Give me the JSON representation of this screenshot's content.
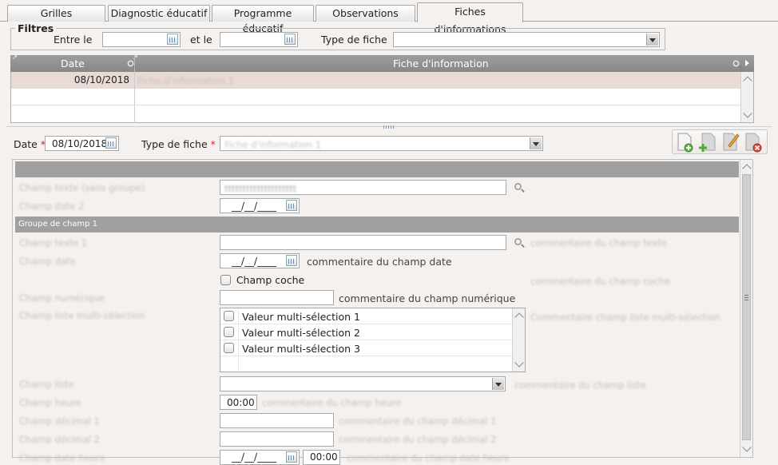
{
  "tabs": [
    "Grilles",
    "Diagnostic éducatif",
    "Programme éducatif",
    "Observations",
    "Fiches d'informations"
  ],
  "filters": {
    "legend": "Filtres",
    "between_label": "Entre le",
    "and_label": "et le",
    "type_label": "Type de fiche",
    "between_value": "",
    "and_value": "",
    "type_value": ""
  },
  "grid": {
    "col_date": "Date",
    "col_fiche": "Fiche d'information",
    "rows": [
      {
        "date": "08/10/2018",
        "fiche": "Fiche d'information 1"
      }
    ]
  },
  "detail": {
    "date_label": "Date",
    "date_value": "08/10/2018",
    "type_label": "Type de fiche",
    "type_value": "Fiche d'information 1",
    "required_mark": "*"
  },
  "form": {
    "field_text_nogroup_label": "Champ texte (sans groupe)",
    "field_text_nogroup_value": "tttttttttttttttttttt",
    "field_date2_label": "Champ date 2",
    "date_placeholder": "__/__/____",
    "group1_title": "Groupe de champ 1",
    "field_text1_label": "Champ texte 1",
    "field_text1_comment": "commentaire du champ texte",
    "field_date_label": "Champ date",
    "field_date_comment": "commentaire du champ date",
    "checkbox_label": "Champ coche",
    "checkbox_comment": "commentaire du champ coche",
    "field_num_label": "Champ numérique",
    "field_num_comment": "commentaire du champ numérique",
    "field_multi_label": "Champ liste multi-sélection",
    "field_multi_comment": "Commentaire champ liste multi-sélection",
    "multi_options": [
      "Valeur multi-sélection 1",
      "Valeur multi-sélection 2",
      "Valeur multi-sélection 3"
    ],
    "field_list_label": "Champ liste",
    "field_list_comment": "commentaire du champ liste",
    "field_hour_label": "Champ heure",
    "field_hour_value": "00:00",
    "field_hour_comment": "commentaire du champ heure",
    "field_dec1_label": "Champ décimal 1",
    "field_dec1_comment": "commentaire du champ décimal 1",
    "field_dec2_label": "Champ décimal 2",
    "field_dec2_comment": "commentaire du champ décimal 2",
    "field_datetime_label": "Champ date heure",
    "field_datetime_hour": "00:00",
    "field_datetime_comment": "commentaire du champ date heure"
  },
  "icons": [
    "calendar-icon",
    "magnifier-icon",
    "new-doc-icon",
    "add-icon",
    "edit-icon",
    "delete-icon",
    "dropdown-arrow-icon",
    "scroll-up-icon",
    "scroll-down-icon"
  ],
  "colors": {
    "background": "#f5f1ee",
    "header_gray": "#9c9c9c",
    "selected_row": "#eadad5",
    "required": "#d22222"
  }
}
